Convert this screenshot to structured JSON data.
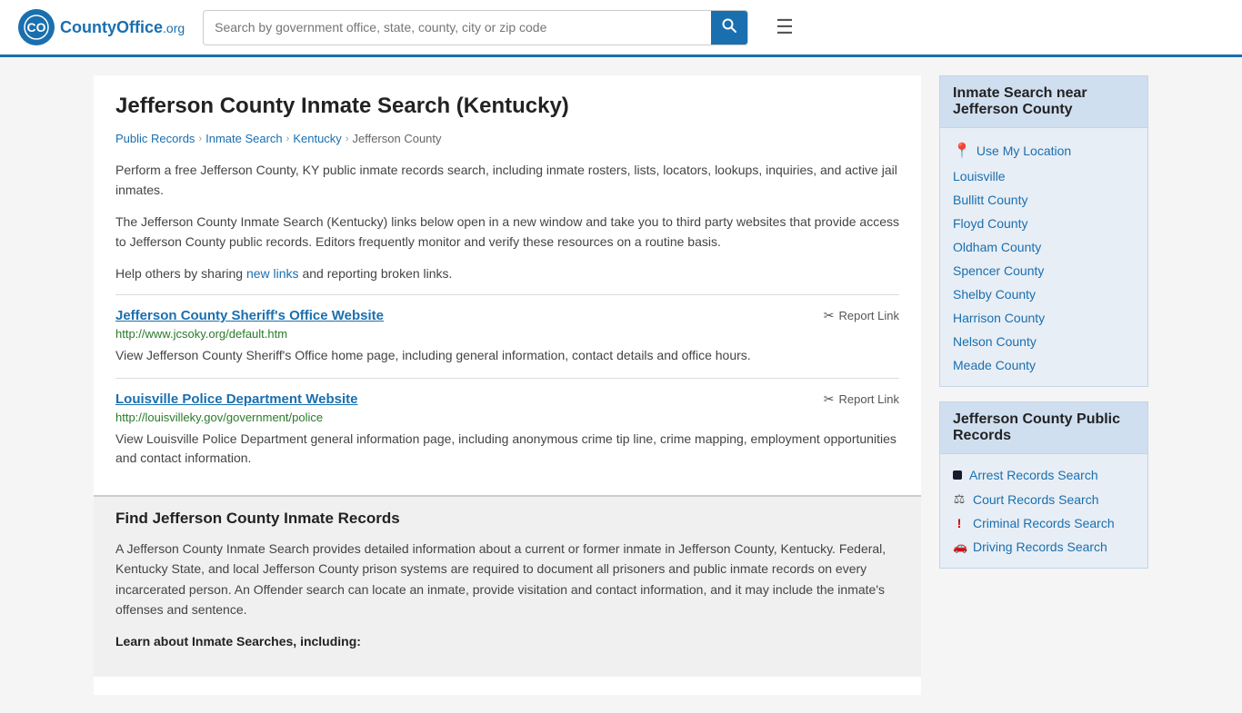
{
  "header": {
    "logo_text": "CountyOffice",
    "logo_org": ".org",
    "search_placeholder": "Search by government office, state, county, city or zip code"
  },
  "breadcrumb": {
    "items": [
      "Public Records",
      "Inmate Search",
      "Kentucky",
      "Jefferson County"
    ]
  },
  "main": {
    "page_title": "Jefferson County Inmate Search (Kentucky)",
    "desc1": "Perform a free Jefferson County, KY public inmate records search, including inmate rosters, lists, locators, lookups, inquiries, and active jail inmates.",
    "desc2": "The Jefferson County Inmate Search (Kentucky) links below open in a new window and take you to third party websites that provide access to Jefferson County public records. Editors frequently monitor and verify these resources on a routine basis.",
    "desc3_pre": "Help others by sharing ",
    "desc3_link": "new links",
    "desc3_post": " and reporting broken links.",
    "links": [
      {
        "title": "Jefferson County Sheriff's Office Website",
        "url": "http://www.jcsoky.org/default.htm",
        "desc": "View Jefferson County Sheriff's Office home page, including general information, contact details and office hours.",
        "report": "Report Link"
      },
      {
        "title": "Louisville Police Department Website",
        "url": "http://louisvilleky.gov/government/police",
        "desc": "View Louisville Police Department general information page, including anonymous crime tip line, crime mapping, employment opportunities and contact information.",
        "report": "Report Link"
      }
    ],
    "find_section": {
      "title": "Find Jefferson County Inmate Records",
      "body": "A Jefferson County Inmate Search provides detailed information about a current or former inmate in Jefferson County, Kentucky. Federal, Kentucky State, and local Jefferson County prison systems are required to document all prisoners and public inmate records on every incarcerated person. An Offender search can locate an inmate, provide visitation and contact information, and it may include the inmate's offenses and sentence.",
      "learn_title": "Learn about Inmate Searches, including:"
    }
  },
  "sidebar": {
    "nearby_title": "Inmate Search near Jefferson County",
    "use_location": "Use My Location",
    "nearby_links": [
      "Louisville",
      "Bullitt County",
      "Floyd County",
      "Oldham County",
      "Spencer County",
      "Shelby County",
      "Harrison County",
      "Nelson County",
      "Meade County"
    ],
    "public_records_title": "Jefferson County Public Records",
    "public_records_links": [
      {
        "label": "Arrest Records Search",
        "icon": "■"
      },
      {
        "label": "Court Records Search",
        "icon": "⚖"
      },
      {
        "label": "Criminal Records Search",
        "icon": "!"
      },
      {
        "label": "Driving Records Search",
        "icon": "🚗"
      }
    ]
  }
}
